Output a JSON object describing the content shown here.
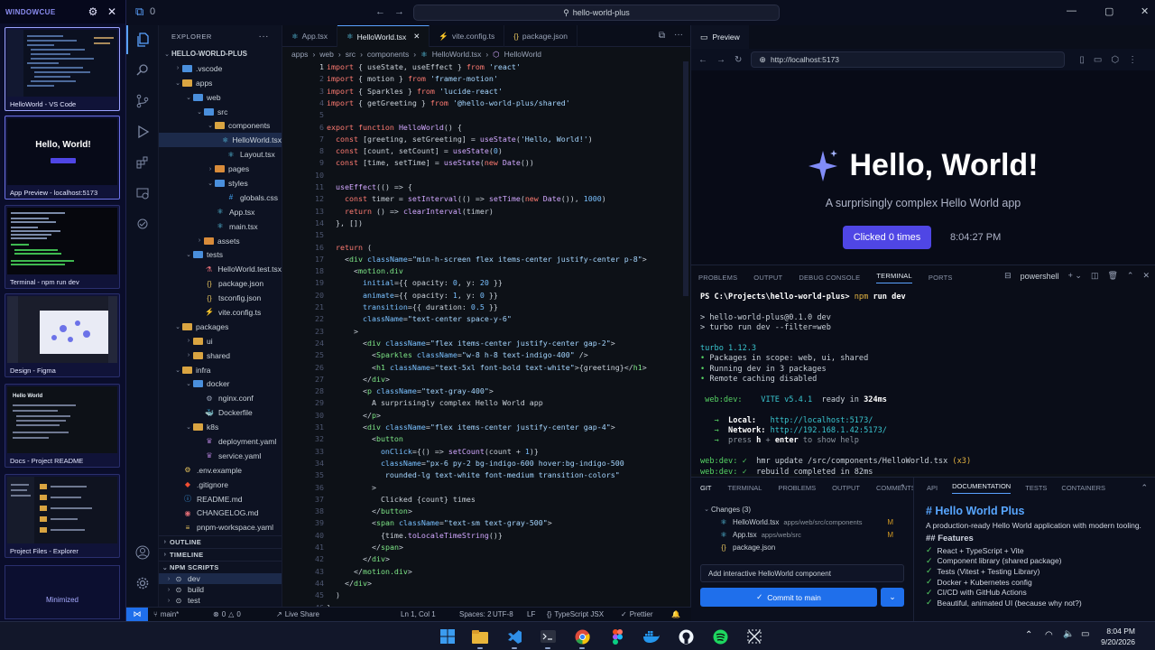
{
  "switcher": {
    "brand": "WINDOWCUE",
    "cards": [
      {
        "label": "HelloWorld - VS Code"
      },
      {
        "label": "App Preview - localhost:5173",
        "thumb_title": "Hello, World!"
      },
      {
        "label": "Terminal - npm run dev"
      },
      {
        "label": "Design - Figma"
      },
      {
        "label": "Docs - Project README",
        "thumb_title": "Hello World"
      },
      {
        "label": "Project Files - Explorer"
      }
    ],
    "minimized": "Minimized"
  },
  "titlebar": {
    "search": "hello-world-plus",
    "badge": "0"
  },
  "explorer": {
    "title": "EXPLORER",
    "tree": [
      {
        "label": "HELLO-WORLD-PLUS",
        "depth": 0,
        "kind": "root"
      },
      {
        "label": ".vscode",
        "depth": 1,
        "kind": "folder",
        "open": false,
        "color": "blue"
      },
      {
        "label": "apps",
        "depth": 1,
        "kind": "folder",
        "open": true
      },
      {
        "label": "web",
        "depth": 2,
        "kind": "folder",
        "open": true,
        "color": "blue"
      },
      {
        "label": "src",
        "depth": 3,
        "kind": "folder",
        "open": true,
        "color": "blue"
      },
      {
        "label": "components",
        "depth": 4,
        "kind": "folder",
        "open": true
      },
      {
        "label": "HelloWorld.tsx",
        "depth": 5,
        "kind": "react",
        "selected": true
      },
      {
        "label": "Layout.tsx",
        "depth": 5,
        "kind": "react"
      },
      {
        "label": "pages",
        "depth": 4,
        "kind": "folder",
        "open": false,
        "color": "orange"
      },
      {
        "label": "styles",
        "depth": 4,
        "kind": "folder",
        "open": true,
        "color": "blue"
      },
      {
        "label": "globals.css",
        "depth": 5,
        "kind": "css"
      },
      {
        "label": "App.tsx",
        "depth": 4,
        "kind": "react"
      },
      {
        "label": "main.tsx",
        "depth": 4,
        "kind": "react"
      },
      {
        "label": "assets",
        "depth": 3,
        "kind": "folder",
        "open": false,
        "color": "orange"
      },
      {
        "label": "tests",
        "depth": 2,
        "kind": "folder",
        "open": true,
        "color": "blue"
      },
      {
        "label": "HelloWorld.test.tsx",
        "depth": 3,
        "kind": "test"
      },
      {
        "label": "package.json",
        "depth": 3,
        "kind": "json"
      },
      {
        "label": "tsconfig.json",
        "depth": 3,
        "kind": "json"
      },
      {
        "label": "vite.config.ts",
        "depth": 3,
        "kind": "vite"
      },
      {
        "label": "packages",
        "depth": 1,
        "kind": "folder",
        "open": true
      },
      {
        "label": "ui",
        "depth": 2,
        "kind": "folder",
        "open": false
      },
      {
        "label": "shared",
        "depth": 2,
        "kind": "folder",
        "open": false
      },
      {
        "label": "infra",
        "depth": 1,
        "kind": "folder",
        "open": true
      },
      {
        "label": "docker",
        "depth": 2,
        "kind": "folder",
        "open": true,
        "color": "blue"
      },
      {
        "label": "nginx.conf",
        "depth": 3,
        "kind": "gear"
      },
      {
        "label": "Dockerfile",
        "depth": 3,
        "kind": "docker"
      },
      {
        "label": "k8s",
        "depth": 2,
        "kind": "folder",
        "open": true
      },
      {
        "label": "deployment.yaml",
        "depth": 3,
        "kind": "yaml"
      },
      {
        "label": "service.yaml",
        "depth": 3,
        "kind": "yaml"
      },
      {
        "label": ".env.example",
        "depth": 1,
        "kind": "env"
      },
      {
        "label": ".gitignore",
        "depth": 1,
        "kind": "git"
      },
      {
        "label": "README.md",
        "depth": 1,
        "kind": "info"
      },
      {
        "label": "CHANGELOG.md",
        "depth": 1,
        "kind": "md"
      },
      {
        "label": "pnpm-workspace.yaml",
        "depth": 1,
        "kind": "yaml2"
      }
    ],
    "sections": {
      "outline": "OUTLINE",
      "timeline": "TIMELINE",
      "npm": "NPM SCRIPTS"
    },
    "scripts": [
      "dev",
      "build",
      "test"
    ]
  },
  "editor": {
    "tabs": [
      {
        "label": "App.tsx",
        "icon": "react"
      },
      {
        "label": "HelloWorld.tsx",
        "icon": "react",
        "active": true
      },
      {
        "label": "vite.config.ts",
        "icon": "vite"
      },
      {
        "label": "package.json",
        "icon": "json"
      }
    ],
    "breadcrumb": [
      "apps",
      "web",
      "src",
      "components",
      "HelloWorld.tsx",
      "HelloWorld"
    ],
    "lines": [
      [
        [
          "k",
          "import"
        ],
        [
          "p",
          " { useState, useEffect } "
        ],
        [
          "k",
          "from"
        ],
        [
          "s",
          " 'react'"
        ]
      ],
      [
        [
          "k",
          "import"
        ],
        [
          "p",
          " { motion } "
        ],
        [
          "k",
          "from"
        ],
        [
          "s",
          " 'framer-motion'"
        ]
      ],
      [
        [
          "k",
          "import"
        ],
        [
          "p",
          " { Sparkles } "
        ],
        [
          "k",
          "from"
        ],
        [
          "s",
          " 'lucide-react'"
        ]
      ],
      [
        [
          "k",
          "import"
        ],
        [
          "p",
          " { getGreeting } "
        ],
        [
          "k",
          "from"
        ],
        [
          "s",
          " '@hello-world-plus/shared'"
        ]
      ],
      [],
      [
        [
          "k",
          "export function "
        ],
        [
          "f",
          "HelloWorld"
        ],
        [
          "p",
          "() {"
        ]
      ],
      [
        [
          "k",
          "  const "
        ],
        [
          "p",
          "[greeting, setGreeting] = "
        ],
        [
          "f",
          "useState"
        ],
        [
          "p",
          "("
        ],
        [
          "s",
          "'Hello, World!'"
        ],
        [
          "p",
          ")"
        ]
      ],
      [
        [
          "k",
          "  const "
        ],
        [
          "p",
          "[count, setCount] = "
        ],
        [
          "f",
          "useState"
        ],
        [
          "p",
          "("
        ],
        [
          "v",
          "0"
        ],
        [
          "p",
          ")"
        ]
      ],
      [
        [
          "k",
          "  const "
        ],
        [
          "p",
          "[time, setTime] = "
        ],
        [
          "f",
          "useState"
        ],
        [
          "p",
          "("
        ],
        [
          "k",
          "new "
        ],
        [
          "f",
          "Date"
        ],
        [
          "p",
          "())"
        ]
      ],
      [],
      [
        [
          "f",
          "  useEffect"
        ],
        [
          "p",
          "(() => {"
        ]
      ],
      [
        [
          "k",
          "    const "
        ],
        [
          "p",
          "timer = "
        ],
        [
          "f",
          "setInterval"
        ],
        [
          "p",
          "(() => "
        ],
        [
          "f",
          "setTime"
        ],
        [
          "p",
          "("
        ],
        [
          "k",
          "new "
        ],
        [
          "f",
          "Date"
        ],
        [
          "p",
          "()), "
        ],
        [
          "v",
          "1000"
        ],
        [
          "p",
          ")"
        ]
      ],
      [
        [
          "k",
          "    return "
        ],
        [
          "p",
          "() => "
        ],
        [
          "f",
          "clearInterval"
        ],
        [
          "p",
          "(timer)"
        ]
      ],
      [
        [
          "p",
          "  }, [])"
        ]
      ],
      [],
      [
        [
          "k",
          "  return "
        ],
        [
          "p",
          "("
        ]
      ],
      [
        [
          "p",
          "    <"
        ],
        [
          "t",
          "div "
        ],
        [
          "v",
          "className"
        ],
        [
          "p",
          "="
        ],
        [
          "s",
          "\"min-h-screen flex items-center justify-center p-8\""
        ],
        [
          "p",
          ">"
        ]
      ],
      [
        [
          "p",
          "      <"
        ],
        [
          "t",
          "motion.div"
        ]
      ],
      [
        [
          "v",
          "        initial"
        ],
        [
          "p",
          "={{ opacity: "
        ],
        [
          "v",
          "0"
        ],
        [
          "p",
          ", y: "
        ],
        [
          "v",
          "20"
        ],
        [
          "p",
          " }}"
        ]
      ],
      [
        [
          "v",
          "        animate"
        ],
        [
          "p",
          "={{ opacity: "
        ],
        [
          "v",
          "1"
        ],
        [
          "p",
          ", y: "
        ],
        [
          "v",
          "0"
        ],
        [
          "p",
          " }}"
        ]
      ],
      [
        [
          "v",
          "        transition"
        ],
        [
          "p",
          "={{ duration: "
        ],
        [
          "v",
          "0.5"
        ],
        [
          "p",
          " }}"
        ]
      ],
      [
        [
          "v",
          "        className"
        ],
        [
          "p",
          "="
        ],
        [
          "s",
          "\"text-center space-y-6\""
        ]
      ],
      [
        [
          "p",
          "      >"
        ]
      ],
      [
        [
          "p",
          "        <"
        ],
        [
          "t",
          "div "
        ],
        [
          "v",
          "className"
        ],
        [
          "p",
          "="
        ],
        [
          "s",
          "\"flex items-center justify-center gap-2\""
        ],
        [
          "p",
          ">"
        ]
      ],
      [
        [
          "p",
          "          <"
        ],
        [
          "t",
          "Sparkles "
        ],
        [
          "v",
          "className"
        ],
        [
          "p",
          "="
        ],
        [
          "s",
          "\"w-8 h-8 text-indigo-400\""
        ],
        [
          "p",
          " />"
        ]
      ],
      [
        [
          "p",
          "          <"
        ],
        [
          "t",
          "h1 "
        ],
        [
          "v",
          "className"
        ],
        [
          "p",
          "="
        ],
        [
          "s",
          "\"text-5xl font-bold text-white\""
        ],
        [
          "p",
          ">{greeting}</"
        ],
        [
          "t",
          "h1"
        ],
        [
          "p",
          ">"
        ]
      ],
      [
        [
          "p",
          "        </"
        ],
        [
          "t",
          "div"
        ],
        [
          "p",
          ">"
        ]
      ],
      [
        [
          "p",
          "        <"
        ],
        [
          "t",
          "p "
        ],
        [
          "v",
          "className"
        ],
        [
          "p",
          "="
        ],
        [
          "s",
          "\"text-gray-400\""
        ],
        [
          "p",
          ">"
        ]
      ],
      [
        [
          "p",
          "          A surprisingly complex Hello World app"
        ]
      ],
      [
        [
          "p",
          "        </"
        ],
        [
          "t",
          "p"
        ],
        [
          "p",
          ">"
        ]
      ],
      [
        [
          "p",
          "        <"
        ],
        [
          "t",
          "div "
        ],
        [
          "v",
          "className"
        ],
        [
          "p",
          "="
        ],
        [
          "s",
          "\"flex items-center justify-center gap-4\""
        ],
        [
          "p",
          ">"
        ]
      ],
      [
        [
          "p",
          "          <"
        ],
        [
          "t",
          "button"
        ]
      ],
      [
        [
          "v",
          "            onClick"
        ],
        [
          "p",
          "={() => "
        ],
        [
          "f",
          "setCount"
        ],
        [
          "p",
          "(count + "
        ],
        [
          "v",
          "1"
        ],
        [
          "p",
          ")}"
        ]
      ],
      [
        [
          "v",
          "            className"
        ],
        [
          "p",
          "="
        ],
        [
          "s",
          "\"px-6 py-2 bg-indigo-600 hover:bg-indigo-500"
        ]
      ],
      [
        [
          "s",
          "             rounded-lg text-white font-medium transition-colors\""
        ]
      ],
      [
        [
          "p",
          "          >"
        ]
      ],
      [
        [
          "p",
          "            Clicked {count} times"
        ]
      ],
      [
        [
          "p",
          "          </"
        ],
        [
          "t",
          "button"
        ],
        [
          "p",
          ">"
        ]
      ],
      [
        [
          "p",
          "          <"
        ],
        [
          "t",
          "span "
        ],
        [
          "v",
          "className"
        ],
        [
          "p",
          "="
        ],
        [
          "s",
          "\"text-sm text-gray-500\""
        ],
        [
          "p",
          ">"
        ]
      ],
      [
        [
          "p",
          "            {time."
        ],
        [
          "f",
          "toLocaleTimeString"
        ],
        [
          "p",
          "()}"
        ]
      ],
      [
        [
          "p",
          "          </"
        ],
        [
          "t",
          "span"
        ],
        [
          "p",
          ">"
        ]
      ],
      [
        [
          "p",
          "        </"
        ],
        [
          "t",
          "div"
        ],
        [
          "p",
          ">"
        ]
      ],
      [
        [
          "p",
          "      </"
        ],
        [
          "t",
          "motion.div"
        ],
        [
          "p",
          ">"
        ]
      ],
      [
        [
          "p",
          "    </"
        ],
        [
          "t",
          "div"
        ],
        [
          "p",
          ">"
        ]
      ],
      [
        [
          "p",
          "  )"
        ]
      ],
      [
        [
          "p",
          "}"
        ]
      ]
    ]
  },
  "preview": {
    "tab": "Preview",
    "url": "http://localhost:5173",
    "heading": "Hello, World!",
    "subtitle": "A surprisingly complex Hello World app",
    "button": "Clicked 0 times",
    "time": "8:04:27 PM"
  },
  "terminal": {
    "tabs": [
      "PROBLEMS",
      "OUTPUT",
      "DEBUG CONSOLE",
      "TERMINAL",
      "PORTS"
    ],
    "active_tab": "TERMINAL",
    "shell": "powershell",
    "lines": [
      [
        [
          "tw",
          "PS C:\\Projects\\hello-world-plus> "
        ],
        [
          "ty",
          "npm"
        ],
        [
          "tw",
          " run dev"
        ]
      ],
      [],
      [
        [
          "p",
          "> hello-world-plus@0.1.0 dev"
        ]
      ],
      [
        [
          "p",
          "> turbo run dev --filter=web"
        ]
      ],
      [],
      [
        [
          "tc",
          "turbo 1.12.3"
        ]
      ],
      [
        [
          "tg",
          "• "
        ],
        [
          "p",
          "Packages in scope: web, ui, shared"
        ]
      ],
      [
        [
          "tg",
          "• "
        ],
        [
          "p",
          "Running dev in 3 packages"
        ]
      ],
      [
        [
          "tg",
          "• "
        ],
        [
          "p",
          "Remote caching disabled"
        ]
      ],
      [],
      [
        [
          "tg",
          " web:dev:    "
        ],
        [
          "tc",
          "VITE v5.4.1"
        ],
        [
          "p",
          "  ready in "
        ],
        [
          "tw",
          "324ms"
        ]
      ],
      [],
      [
        [
          "tg",
          "   → "
        ],
        [
          "tw",
          " Local:   "
        ],
        [
          "tc",
          "http://localhost:5173/"
        ]
      ],
      [
        [
          "tg",
          "   → "
        ],
        [
          "tw",
          " Network: "
        ],
        [
          "tc",
          "http://192.168.1.42:5173/"
        ]
      ],
      [
        [
          "tg",
          "   → "
        ],
        [
          "td",
          " press "
        ],
        [
          "tw",
          "h"
        ],
        [
          "td",
          " + "
        ],
        [
          "tw",
          "enter"
        ],
        [
          "td",
          " to show help"
        ]
      ],
      [],
      [
        [
          "tg",
          "web:dev:"
        ],
        [
          "tg",
          " ✓ "
        ],
        [
          "p",
          " hmr update /src/components/HelloWorld.tsx "
        ],
        [
          "ty",
          "(x3)"
        ]
      ],
      [
        [
          "tg",
          "web:dev:"
        ],
        [
          "tg",
          " ✓ "
        ],
        [
          "p",
          " rebuild completed in 82ms"
        ]
      ]
    ]
  },
  "git": {
    "tabs": [
      "GIT",
      "TERMINAL",
      "PROBLEMS",
      "OUTPUT",
      "COMMENTS"
    ],
    "changes": "Changes (3)",
    "files": [
      {
        "name": "HelloWorld.tsx",
        "path": "apps/web/src/components",
        "status": "M",
        "icon": "react"
      },
      {
        "name": "App.tsx",
        "path": "apps/web/src",
        "status": "M",
        "icon": "react"
      },
      {
        "name": "package.json",
        "path": "",
        "status": "",
        "icon": "json"
      }
    ],
    "commit_message": "Add interactive HelloWorld component",
    "commit_button": "Commit to main"
  },
  "docs": {
    "tabs": [
      "API",
      "DOCUMENTATION",
      "TESTS",
      "CONTAINERS"
    ],
    "active_tab": "DOCUMENTATION",
    "title": "# Hello World Plus",
    "intro": "A production-ready Hello World application with modern tooling.",
    "features_heading": "## Features",
    "features": [
      "React + TypeScript + Vite",
      "Component library (shared package)",
      "Tests (Vitest + Testing Library)",
      "Docker + Kubernetes config",
      "CI/CD with GitHub Actions",
      "Beautiful, animated UI (because why not?)"
    ]
  },
  "status": {
    "branch": "main*",
    "errors": "0",
    "warnings": "0",
    "liveshare": "Live Share",
    "position": "Ln 1, Col 1",
    "spaces": "Spaces: 2",
    "encoding": "UTF-8",
    "eol": "LF",
    "language": "TypeScript JSX",
    "formatter": "Prettier"
  },
  "taskbar": {
    "time": "8:04 PM",
    "date": "9/20/2026"
  },
  "colors": {
    "accent": "#5aa2ff",
    "indigo": "#4f46e5",
    "commit": "#1f6feb"
  }
}
